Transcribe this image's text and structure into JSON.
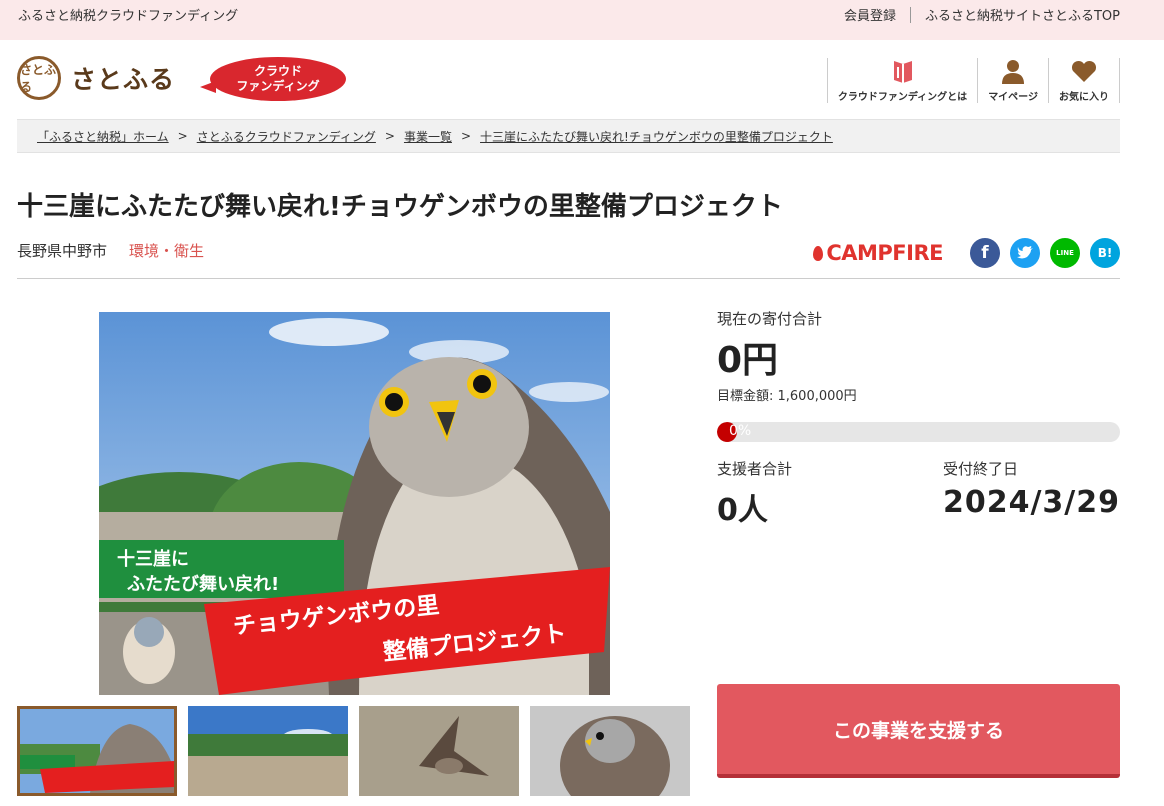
{
  "topbar": {
    "site_name": "ふるさと納税クラウドファンディング",
    "links": [
      "会員登録",
      "ふるさと納税サイトさとふるTOP"
    ]
  },
  "header": {
    "logo_seal": "さとふ る",
    "logo_text": "さとふる",
    "badge_line1": "クラウド",
    "badge_line2": "ファンディング",
    "nav": [
      {
        "label": "クラウドファンディングとは",
        "icon": "book-icon"
      },
      {
        "label": "マイページ",
        "icon": "user-icon"
      },
      {
        "label": "お気に入り",
        "icon": "heart-icon"
      }
    ]
  },
  "breadcrumb": [
    "「ふるさと納税」ホーム",
    "さとふるクラウドファンディング",
    "事業一覧",
    "十三崖にふたたび舞い戻れ!チョウゲンボウの里整備プロジェクト"
  ],
  "breadcrumb_sep": ">",
  "project": {
    "title": "十三崖にふたたび舞い戻れ!チョウゲンボウの里整備プロジェクト",
    "location": "長野県中野市",
    "category": "環境・衛生"
  },
  "share": {
    "campfire": "CAMPFIRE",
    "buttons": [
      {
        "name": "facebook",
        "glyph": "f",
        "color": "#3b5998"
      },
      {
        "name": "twitter",
        "glyph": "t",
        "color": "#1da1f2"
      },
      {
        "name": "line",
        "glyph": "LINE",
        "color": "#00b900"
      },
      {
        "name": "hatena",
        "glyph": "B!",
        "color": "#00a4de"
      }
    ]
  },
  "image_text": {
    "green_line1": "十三崖に",
    "green_line2": "ふたたび舞い戻れ!",
    "red_line1": "チョウゲンボウの里",
    "red_line2": "整備プロジェクト"
  },
  "funding": {
    "current_label": "現在の寄付合計",
    "current_amount": "0円",
    "goal_label": "目標金額: 1,600,000円",
    "progress_text": "0%",
    "progress_fraction": 0,
    "supporters_label": "支援者合計",
    "supporters_value": "0人",
    "end_label": "受付終了日",
    "end_value": "2024/3/29",
    "support_button": "この事業を支援する"
  },
  "colors": {
    "accent_red": "#e2585f",
    "topbar_pink": "#fbe9ea",
    "brand_brown": "#8a5a2b"
  }
}
